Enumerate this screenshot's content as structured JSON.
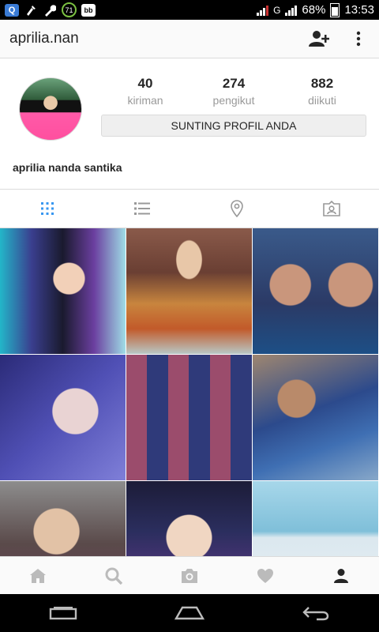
{
  "status_bar": {
    "battery": "68%",
    "time": "13:53",
    "notification_badge": "71",
    "network": "G"
  },
  "header": {
    "username": "aprilia.nan"
  },
  "profile": {
    "stats": [
      {
        "value": "40",
        "label": "kiriman"
      },
      {
        "value": "274",
        "label": "pengikut"
      },
      {
        "value": "882",
        "label": "diikuti"
      }
    ],
    "edit_button": "SUNTING PROFIL ANDA",
    "full_name": "aprilia nanda santika"
  },
  "tabs": [
    "grid-icon",
    "list-icon",
    "location-icon",
    "tagged-icon"
  ],
  "active_tab_color": "#3897f0",
  "grid_posts": [
    {
      "label": "post-1"
    },
    {
      "label": "post-2"
    },
    {
      "label": "post-3"
    },
    {
      "label": "post-4"
    },
    {
      "label": "post-5"
    },
    {
      "label": "post-6"
    },
    {
      "label": "post-7"
    },
    {
      "label": "post-8"
    },
    {
      "label": "post-9"
    }
  ],
  "bottom_nav": [
    "home-icon",
    "search-icon",
    "camera-icon",
    "heart-icon",
    "profile-icon"
  ]
}
